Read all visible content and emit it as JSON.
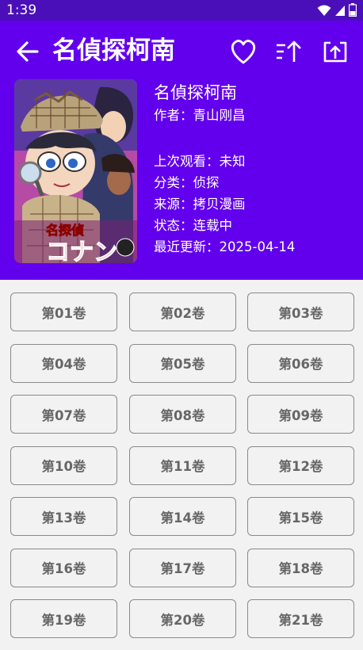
{
  "status_bar": {
    "time": "1:39",
    "icons": [
      "wifi-icon",
      "signal-icon",
      "battery-icon"
    ]
  },
  "header": {
    "title": "名偵探柯南",
    "actions": [
      "heart-icon",
      "sort-icon",
      "share-icon"
    ]
  },
  "comic": {
    "name": "名偵探柯南",
    "author": "作者：青山刚昌",
    "last_watched": "上次观看：未知",
    "category": "分类：侦探",
    "source": "来源：拷贝漫画",
    "status": "状态：连载中",
    "updated": "最近更新：2025-04-14",
    "cover_text": "名探偵コナン"
  },
  "volumes": [
    "第01卷",
    "第02卷",
    "第03卷",
    "第04卷",
    "第05卷",
    "第06卷",
    "第07卷",
    "第08卷",
    "第09卷",
    "第10卷",
    "第11卷",
    "第12卷",
    "第13卷",
    "第14卷",
    "第15卷",
    "第16卷",
    "第17卷",
    "第18卷",
    "第19卷",
    "第20卷",
    "第21卷"
  ],
  "colors": {
    "primary": "#6200ee",
    "status_bar": "#4a0fb8",
    "background": "#f2f2f2"
  }
}
